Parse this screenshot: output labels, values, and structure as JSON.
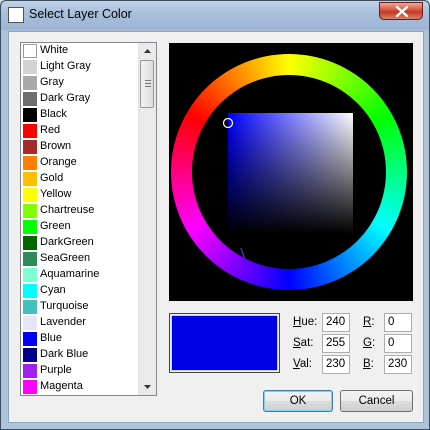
{
  "window": {
    "title": "Select Layer Color"
  },
  "colors": [
    {
      "label": "White",
      "color": "#ffffff"
    },
    {
      "label": "Light Gray",
      "color": "#d3d3d3"
    },
    {
      "label": "Gray",
      "color": "#a9a9a9"
    },
    {
      "label": "Dark Gray",
      "color": "#6e6e6e"
    },
    {
      "label": "Black",
      "color": "#000000"
    },
    {
      "label": "Red",
      "color": "#ff0000"
    },
    {
      "label": "Brown",
      "color": "#a52a2a"
    },
    {
      "label": "Orange",
      "color": "#ff8000"
    },
    {
      "label": "Gold",
      "color": "#ffbf00"
    },
    {
      "label": "Yellow",
      "color": "#ffff00"
    },
    {
      "label": "Chartreuse",
      "color": "#80ff00"
    },
    {
      "label": "Green",
      "color": "#00ff00"
    },
    {
      "label": "DarkGreen",
      "color": "#006400"
    },
    {
      "label": "SeaGreen",
      "color": "#2e8b57"
    },
    {
      "label": "Aquamarine",
      "color": "#7fffd4"
    },
    {
      "label": "Cyan",
      "color": "#00ffff"
    },
    {
      "label": "Turquoise",
      "color": "#40c0c0"
    },
    {
      "label": "Lavender",
      "color": "#e6e6fa"
    },
    {
      "label": "Blue",
      "color": "#0000ff"
    },
    {
      "label": "Dark Blue",
      "color": "#00008b"
    },
    {
      "label": "Purple",
      "color": "#a020f0"
    },
    {
      "label": "Magenta",
      "color": "#ff00ff"
    }
  ],
  "current_color": "#0000e6",
  "fields": {
    "hue": {
      "label_key": "H",
      "label_rest": "ue:",
      "value": "240"
    },
    "sat": {
      "label_key": "S",
      "label_rest": "at:",
      "value": "255"
    },
    "val": {
      "label_key": "V",
      "label_rest": "al:",
      "value": "230"
    },
    "r": {
      "label_key": "R",
      "label_rest": ":",
      "value": "0"
    },
    "g": {
      "label_key": "G",
      "label_rest": ":",
      "value": "0"
    },
    "b": {
      "label_key": "B",
      "label_rest": ":",
      "value": "230"
    }
  },
  "buttons": {
    "ok": "OK",
    "cancel": "Cancel"
  }
}
